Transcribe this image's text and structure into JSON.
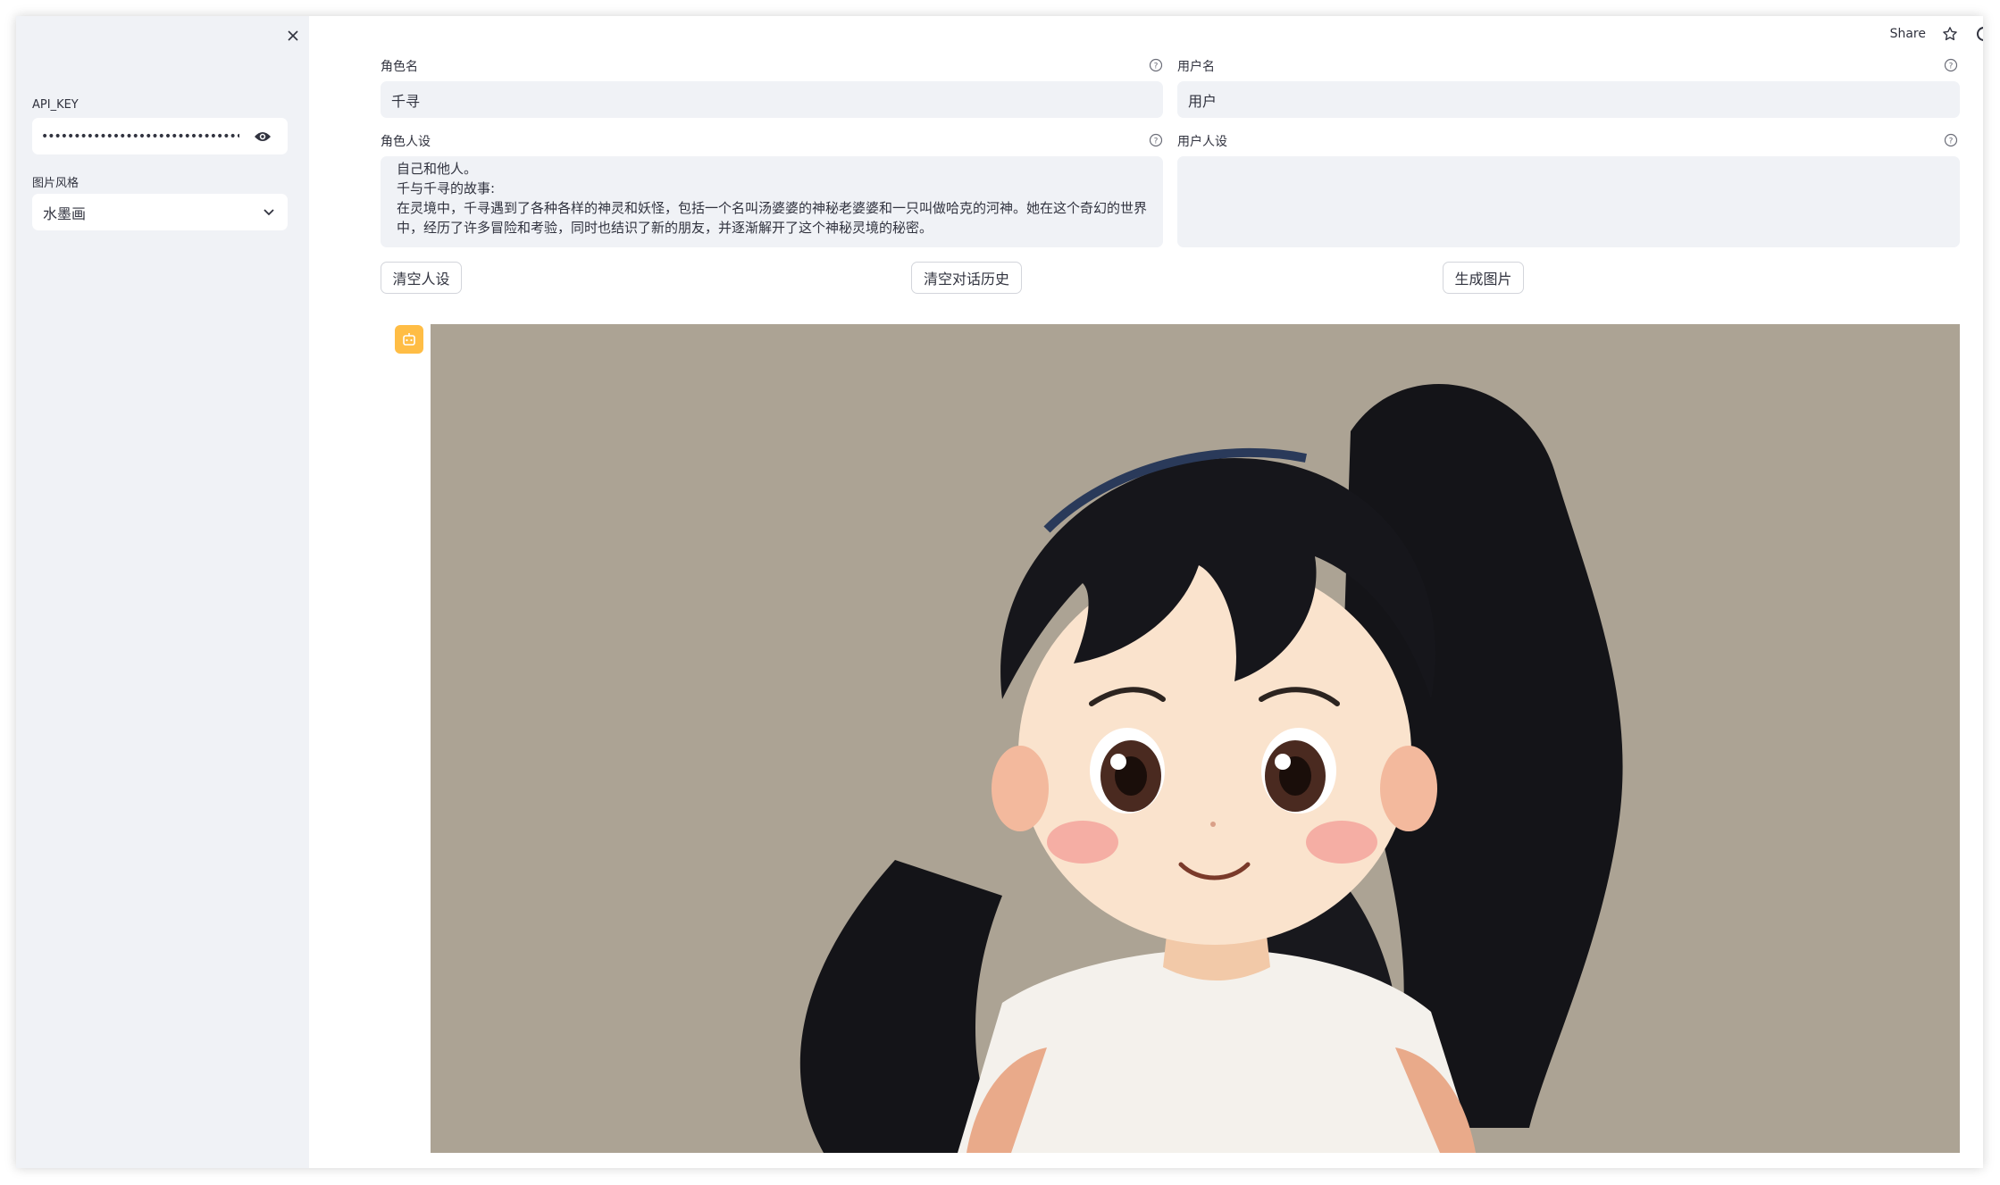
{
  "sidebar": {
    "api_key_label": "API_KEY",
    "api_key_masked": "••••••••••••••••••••••••••••••••••••••••••••••••••••",
    "style_label": "图片风格",
    "style_value": "水墨画",
    "close_icon": "close-icon",
    "eye_icon": "eye-icon",
    "chevron_icon": "chevron-down-icon"
  },
  "topbar": {
    "share_label": "Share",
    "star_icon": "star-icon",
    "theme_icon": "moon-icon"
  },
  "form": {
    "role_name_label": "角色名",
    "role_name_value": "千寻",
    "user_name_label": "用户名",
    "user_name_value": "用户",
    "role_persona_label": "角色人设",
    "role_persona_value": "自己和他人。\n千与千寻的故事:\n在灵境中，千寻遇到了各种各样的神灵和妖怪，包括一个名叫汤婆婆的神秘老婆婆和一只叫做哈克的河神。她在这个奇幻的世界中，经历了许多冒险和考验，同时也结识了新的朋友，并逐渐解开了这个神秘灵境的秘密。",
    "user_persona_label": "用户人设",
    "user_persona_value": ""
  },
  "buttons": {
    "clear_persona": "清空人设",
    "clear_history": "清空对话历史",
    "generate_image": "生成图片"
  },
  "chat": {
    "avatar_icon": "bot-icon",
    "image_subject": "cartoon-girl-portrait"
  },
  "colors": {
    "sidebar_bg": "#f0f2f6",
    "avatar_bg": "#ffbd45",
    "image_bg": "#aaa294"
  }
}
